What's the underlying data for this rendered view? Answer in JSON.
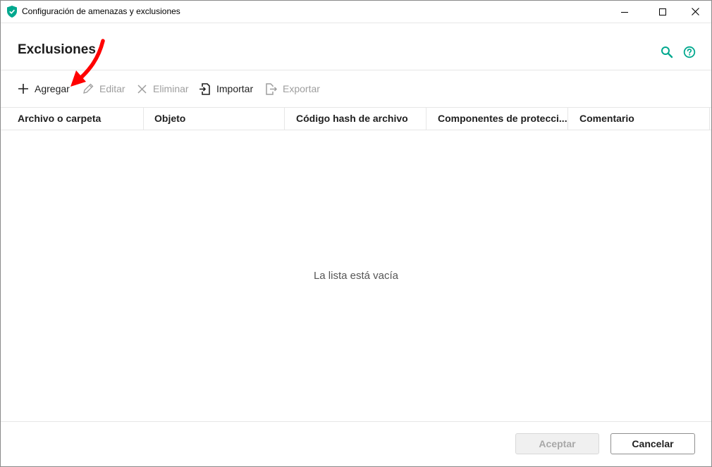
{
  "window": {
    "title": "Configuración de amenazas y exclusiones",
    "accent_color": "#00a88e"
  },
  "page": {
    "title": "Exclusiones"
  },
  "header_icons": [
    "search-icon",
    "help-icon"
  ],
  "toolbar": {
    "add_label": "Agregar",
    "edit_label": "Editar",
    "delete_label": "Eliminar",
    "import_label": "Importar",
    "export_label": "Exportar"
  },
  "table": {
    "columns": [
      "Archivo o carpeta",
      "Objeto",
      "Código hash de archivo",
      "Componentes de protecci...",
      "Comentario"
    ],
    "empty_message": "La lista está vacía"
  },
  "footer": {
    "accept_label": "Aceptar",
    "cancel_label": "Cancelar"
  },
  "annotation": {
    "color": "#ff0000"
  }
}
